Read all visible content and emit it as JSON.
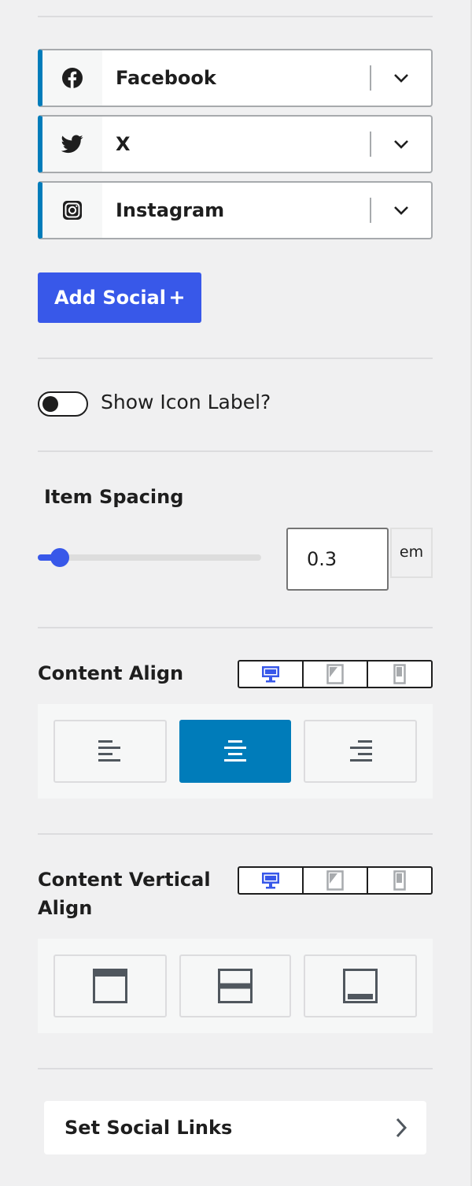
{
  "socials": [
    {
      "label": "Facebook",
      "icon": "facebook-icon"
    },
    {
      "label": "X",
      "icon": "twitter-bird-icon"
    },
    {
      "label": "Instagram",
      "icon": "instagram-icon"
    }
  ],
  "add_social": {
    "label": "Add Social",
    "icon": "plus-icon"
  },
  "show_icon_label": {
    "label": "Show Icon Label?",
    "checked": false
  },
  "item_spacing": {
    "title": "Item Spacing",
    "value": "0.3",
    "unit": "em",
    "slider_fraction": 0.1
  },
  "content_align": {
    "title": "Content Align",
    "device_active": "desktop",
    "selected": "center",
    "options": [
      "left",
      "center",
      "right"
    ]
  },
  "content_vertical_align": {
    "title_line1": "Content Vertical",
    "title_line2": "Align",
    "device_active": "desktop",
    "options": [
      "top",
      "middle",
      "bottom"
    ]
  },
  "set_social_links": {
    "label": "Set Social Links"
  },
  "colors": {
    "accent_blue": "#3858e9",
    "wp_blue": "#007cba",
    "border_grey": "#a7aaad",
    "text": "#1e1e1e"
  }
}
